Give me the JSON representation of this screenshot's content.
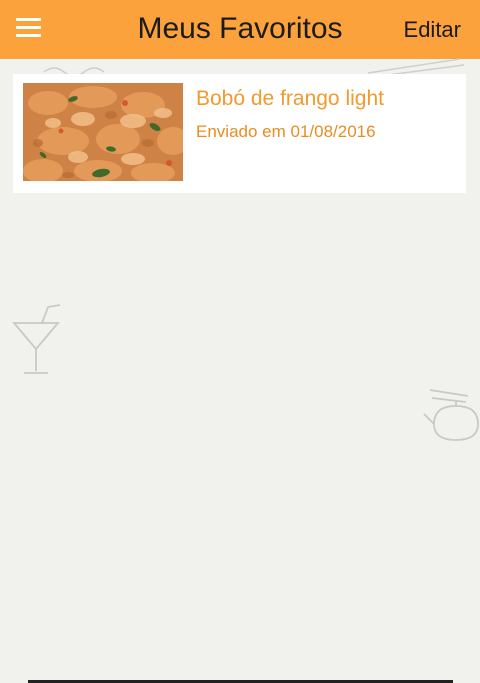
{
  "header": {
    "title": "Meus Favoritos",
    "edit_label": "Editar",
    "menu_icon": "hamburger-menu-icon",
    "background_color": "#fba23c"
  },
  "favorites": [
    {
      "title": "Bobó de frango light",
      "sent_label": "Enviado em 01/08/2016",
      "image": "chicken-bobo-photo"
    }
  ],
  "colors": {
    "background": "#f1f2ee",
    "accent_text": "#f29a2e",
    "card_background": "#ffffff"
  }
}
